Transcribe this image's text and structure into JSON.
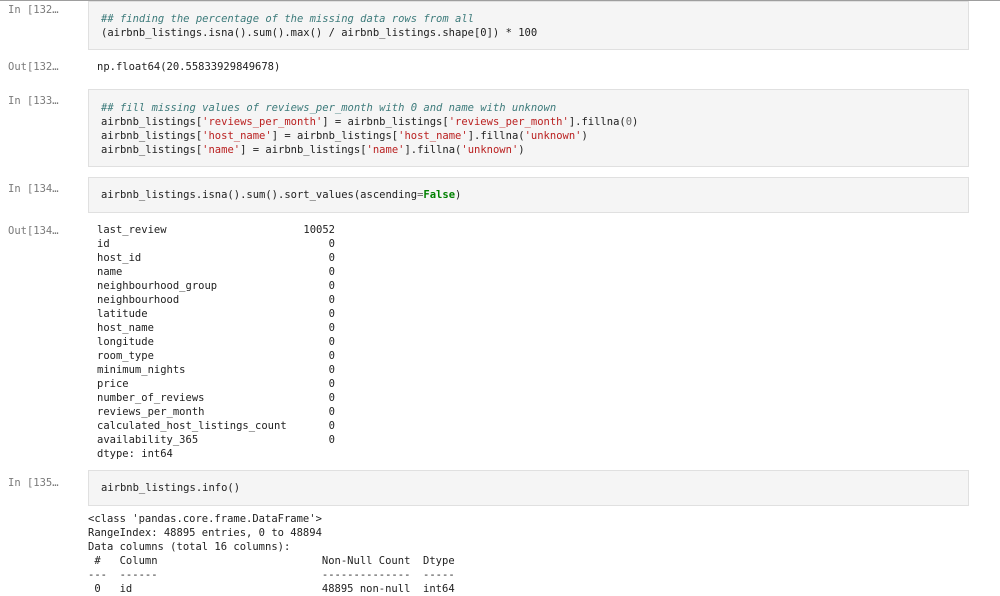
{
  "cells": {
    "c132": {
      "in_prompt": "In [132…",
      "comment": "## finding the percentage of the missing data rows from all",
      "code": "(airbnb_listings.isna().sum().max() / airbnb_listings.shape[0]) * 100",
      "out_prompt": "Out[132…",
      "output": "np.float64(20.55833929849678)"
    },
    "c133": {
      "in_prompt": "In [133…",
      "comment": "## fill missing values of reviews_per_month with 0 and name with unknown",
      "line1a": "airbnb_listings[",
      "line1s": "'reviews_per_month'",
      "line1b": "] = airbnb_listings[",
      "line1s2": "'reviews_per_month'",
      "line1c": "].fillna(",
      "line1n": "0",
      "line1d": ")",
      "line2a": "airbnb_listings[",
      "line2s": "'host_name'",
      "line2b": "] = airbnb_listings[",
      "line2s2": "'host_name'",
      "line2c": "].fillna(",
      "line2s3": "'unknown'",
      "line2d": ")",
      "line3a": "airbnb_listings[",
      "line3s": "'name'",
      "line3b": "] = airbnb_listings[",
      "line3s2": "'name'",
      "line3c": "].fillna(",
      "line3s3": "'unknown'",
      "line3d": ")"
    },
    "c134": {
      "in_prompt": "In [134…",
      "code_a": "airbnb_listings.isna().sum().sort_values(ascending",
      "code_eq": "=",
      "code_kw": "False",
      "code_b": ")",
      "out_prompt": "Out[134…",
      "series": [
        {
          "name": "last_review",
          "value": "10052"
        },
        {
          "name": "id",
          "value": "0"
        },
        {
          "name": "host_id",
          "value": "0"
        },
        {
          "name": "name",
          "value": "0"
        },
        {
          "name": "neighbourhood_group",
          "value": "0"
        },
        {
          "name": "neighbourhood",
          "value": "0"
        },
        {
          "name": "latitude",
          "value": "0"
        },
        {
          "name": "host_name",
          "value": "0"
        },
        {
          "name": "longitude",
          "value": "0"
        },
        {
          "name": "room_type",
          "value": "0"
        },
        {
          "name": "minimum_nights",
          "value": "0"
        },
        {
          "name": "price",
          "value": "0"
        },
        {
          "name": "number_of_reviews",
          "value": "0"
        },
        {
          "name": "reviews_per_month",
          "value": "0"
        },
        {
          "name": "calculated_host_listings_count",
          "value": "0"
        },
        {
          "name": "availability_365",
          "value": "0"
        }
      ],
      "dtype": "dtype: int64"
    },
    "c135": {
      "in_prompt": "In [135…",
      "code": "airbnb_listings.info()",
      "info_lines": [
        "<class 'pandas.core.frame.DataFrame'>",
        "RangeIndex: 48895 entries, 0 to 48894",
        "Data columns (total 16 columns):",
        " #   Column                          Non-Null Count  Dtype  ",
        "---  ------                          --------------  -----  ",
        " 0   id                              48895 non-null  int64  "
      ]
    }
  }
}
